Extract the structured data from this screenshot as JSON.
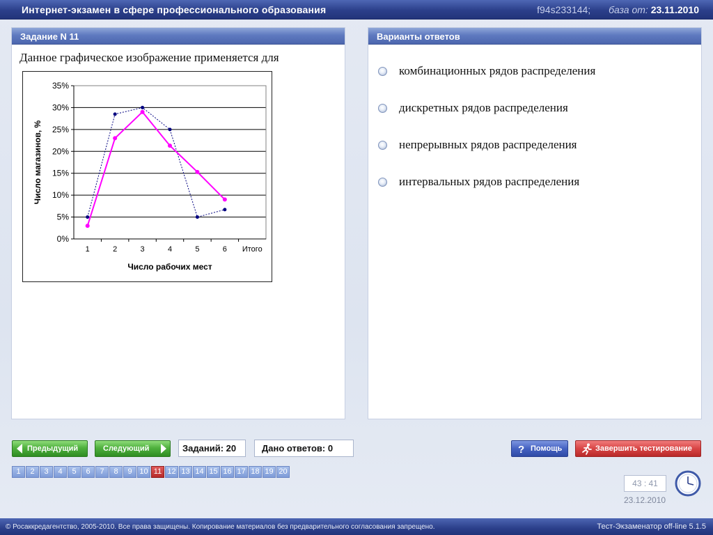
{
  "header": {
    "title": "Интернет-экзамен в сфере профессионального образования",
    "session_id": "f94s233144;",
    "db_label": "база от:",
    "db_date": "23.11.2010"
  },
  "question_panel": {
    "title": "Задание N 11",
    "text": "Данное графическое изображение применяется для"
  },
  "answers_panel": {
    "title": "Варианты ответов",
    "options": [
      "комбинационных рядов распределения",
      "дискретных рядов распределения",
      "непрерывных рядов распределения",
      "интервальных рядов распределения"
    ]
  },
  "toolbar": {
    "prev_label": "Предыдущий",
    "next_label": "Следующий",
    "tasks_label": "Заданий: 20",
    "answers_label": "Дано ответов: 0",
    "help_label": "Помощь",
    "finish_label": "Завершить тестирование"
  },
  "pages": [
    "1",
    "2",
    "3",
    "4",
    "5",
    "6",
    "7",
    "8",
    "9",
    "10",
    "11",
    "12",
    "13",
    "14",
    "15",
    "16",
    "17",
    "18",
    "19",
    "20"
  ],
  "active_page": "11",
  "timer": "43 : 41",
  "date": "23.12.2010",
  "footer": {
    "copyright": "© Росаккредагентство, 2005-2010. Все права защищены. Копирование материалов без предварительного согласования запрещено.",
    "version": "Тест-Экзаменатор off-line 5.1.5"
  },
  "colors": {
    "accent_blue": "#2b3f8a",
    "series_magenta": "#ff00ff",
    "series_navy": "#000080",
    "active_page": "#b62a2a"
  },
  "chart_data": {
    "type": "line",
    "categories": [
      "1",
      "2",
      "3",
      "4",
      "5",
      "6",
      "Итого"
    ],
    "series": [
      {
        "values": [
          5,
          28.5,
          30,
          25,
          5,
          6.7,
          null
        ],
        "style": "dotted",
        "color": "#000080"
      },
      {
        "values": [
          3,
          23,
          29,
          21.3,
          15.3,
          9,
          null
        ],
        "style": "solid",
        "color": "#ff00ff"
      }
    ],
    "yticks": [
      "0%",
      "5%",
      "10%",
      "15%",
      "20%",
      "25%",
      "30%",
      "35%"
    ],
    "ylim": [
      0,
      35
    ],
    "xlabel": "Число рабочих мест",
    "ylabel": "Число магазинов, %",
    "grid": true
  }
}
